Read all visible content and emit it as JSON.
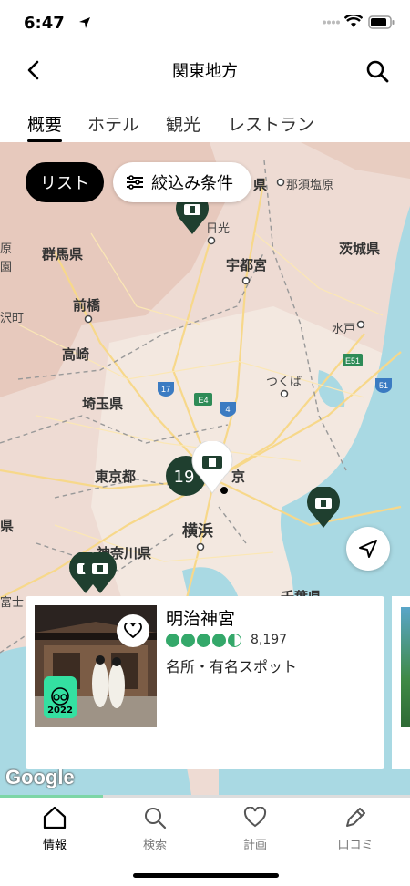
{
  "status_bar": {
    "time": "6:47"
  },
  "header": {
    "title": "関東地方"
  },
  "tabs": [
    {
      "label": "概要",
      "active": true
    },
    {
      "label": "ホテル",
      "active": false
    },
    {
      "label": "観光",
      "active": false
    },
    {
      "label": "レストラン",
      "active": false
    }
  ],
  "map": {
    "list_button": "リスト",
    "filter_button": "絞込み条件",
    "labels": {
      "nasushiobara": "那須塩原",
      "ken_top": "県",
      "nikko": "日光",
      "gunma": "群馬県",
      "utsunomiya": "宇都宮",
      "ibaraki": "茨城県",
      "maebashi": "前橋",
      "takasaki": "高崎",
      "mito": "水戸",
      "tsukuba": "つくば",
      "saitama": "埼玉県",
      "tokyo": "東京都",
      "kyo": "京",
      "yokohama": "横浜",
      "kanagawa": "神奈川県",
      "chiba": "千葉県",
      "ken_left": "県",
      "fuji": "富士",
      "taku": "沢町",
      "hara": "原",
      "en": "園"
    },
    "road_signs": [
      "17",
      "E4",
      "4",
      "E51",
      "51"
    ],
    "cluster_count": "19",
    "google": "Google"
  },
  "card": {
    "name": "明治神宮",
    "rating": 4.5,
    "review_count": "8,197",
    "category": "名所・有名スポット",
    "badge_year": "2022"
  },
  "carousel_progress": 0.25,
  "bottom_nav": [
    {
      "label": "情報",
      "icon": "home-icon",
      "active": true
    },
    {
      "label": "検索",
      "icon": "search-icon",
      "active": false
    },
    {
      "label": "計画",
      "icon": "heart-icon",
      "active": false
    },
    {
      "label": "口コミ",
      "icon": "pencil-icon",
      "active": false
    }
  ],
  "colors": {
    "accent": "#34a86a",
    "map_land": "#eedbd3",
    "map_sea": "#a9d9e3",
    "pin": "#1f3f2f"
  }
}
